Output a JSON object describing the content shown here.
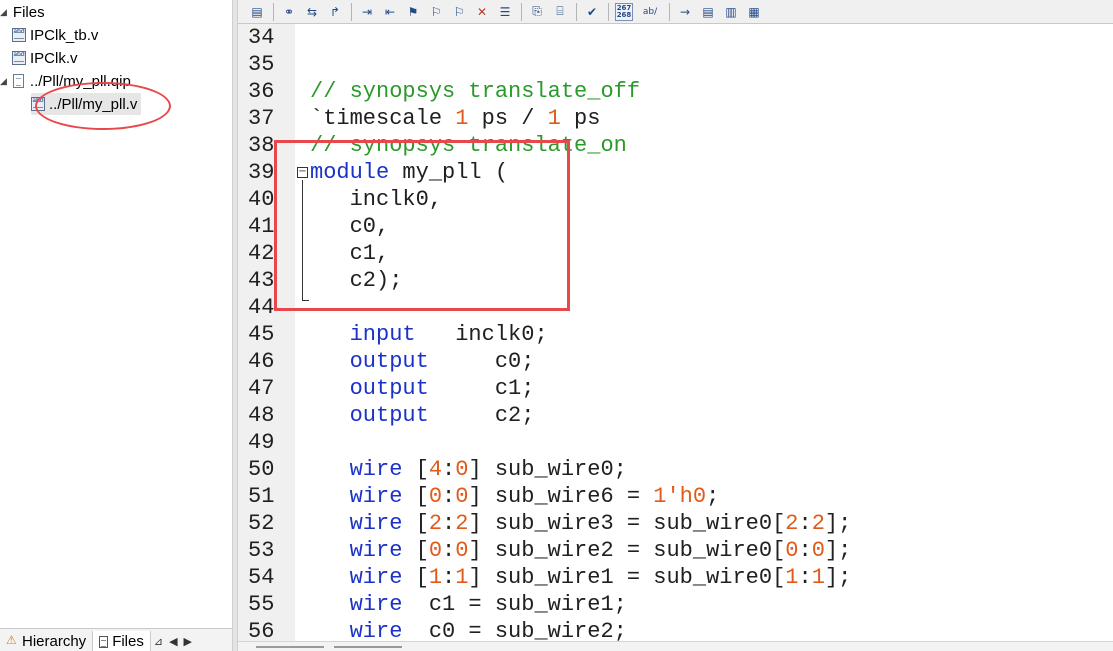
{
  "project_pane": {
    "root_label": "Files",
    "items": [
      {
        "label": "IPClk_tb.v"
      },
      {
        "label": "IPClk.v"
      },
      {
        "label": "../Pll/my_pll.qip"
      },
      {
        "label": "../Pll/my_pll.v"
      }
    ],
    "tabs": [
      {
        "label": "Hierarchy",
        "icon": "warning-hierarchy-icon"
      },
      {
        "label": "Files",
        "icon": "file-icon"
      }
    ]
  },
  "toolbar": {
    "icons": [
      "document-icon",
      "binoculars-icon",
      "replace-icon",
      "goto-icon",
      "indent-icon",
      "unindent-icon",
      "bookmark-icon",
      "bookmark-next-icon",
      "bookmark-prev-icon",
      "bookmark-clear-icon",
      "bookmark-list-icon",
      "paperclip-icon",
      "scroll-icon",
      "check-icon",
      "line-number-icon",
      "ab-icon",
      "arrow-right-icon",
      "text-wrap-icon",
      "text-list-icon",
      "text-block-icon"
    ],
    "line_number_label": "267\n268",
    "ab_label": "ab/"
  },
  "editor": {
    "lines": [
      {
        "n": "34",
        "tokens": []
      },
      {
        "n": "35",
        "tokens": []
      },
      {
        "n": "36",
        "tokens": [
          {
            "t": "// synopsys translate_off",
            "c": "com"
          }
        ]
      },
      {
        "n": "37",
        "tokens": [
          {
            "t": "`timescale ",
            "c": ""
          },
          {
            "t": "1",
            "c": "num"
          },
          {
            "t": " ps / ",
            "c": ""
          },
          {
            "t": "1",
            "c": "num"
          },
          {
            "t": " ps",
            "c": ""
          }
        ]
      },
      {
        "n": "38",
        "tokens": [
          {
            "t": "// synopsys translate_on",
            "c": "com"
          }
        ]
      },
      {
        "n": "39",
        "tokens": [
          {
            "t": "module",
            "c": "kw"
          },
          {
            "t": " my_pll (",
            "c": ""
          }
        ]
      },
      {
        "n": "40",
        "tokens": [
          {
            "t": "   inclk0,",
            "c": ""
          }
        ]
      },
      {
        "n": "41",
        "tokens": [
          {
            "t": "   c0,",
            "c": ""
          }
        ]
      },
      {
        "n": "42",
        "tokens": [
          {
            "t": "   c1,",
            "c": ""
          }
        ]
      },
      {
        "n": "43",
        "tokens": [
          {
            "t": "   c2);",
            "c": ""
          }
        ]
      },
      {
        "n": "44",
        "tokens": []
      },
      {
        "n": "45",
        "tokens": [
          {
            "t": "   ",
            "c": ""
          },
          {
            "t": "input",
            "c": "kw"
          },
          {
            "t": "   inclk0;",
            "c": ""
          }
        ]
      },
      {
        "n": "46",
        "tokens": [
          {
            "t": "   ",
            "c": ""
          },
          {
            "t": "output",
            "c": "kw"
          },
          {
            "t": "     c0;",
            "c": ""
          }
        ]
      },
      {
        "n": "47",
        "tokens": [
          {
            "t": "   ",
            "c": ""
          },
          {
            "t": "output",
            "c": "kw"
          },
          {
            "t": "     c1;",
            "c": ""
          }
        ]
      },
      {
        "n": "48",
        "tokens": [
          {
            "t": "   ",
            "c": ""
          },
          {
            "t": "output",
            "c": "kw"
          },
          {
            "t": "     c2;",
            "c": ""
          }
        ]
      },
      {
        "n": "49",
        "tokens": []
      },
      {
        "n": "50",
        "tokens": [
          {
            "t": "   ",
            "c": ""
          },
          {
            "t": "wire",
            "c": "kw"
          },
          {
            "t": " [",
            "c": ""
          },
          {
            "t": "4",
            "c": "num"
          },
          {
            "t": ":",
            "c": ""
          },
          {
            "t": "0",
            "c": "num"
          },
          {
            "t": "] sub_wire0;",
            "c": ""
          }
        ]
      },
      {
        "n": "51",
        "tokens": [
          {
            "t": "   ",
            "c": ""
          },
          {
            "t": "wire",
            "c": "kw"
          },
          {
            "t": " [",
            "c": ""
          },
          {
            "t": "0",
            "c": "num"
          },
          {
            "t": ":",
            "c": ""
          },
          {
            "t": "0",
            "c": "num"
          },
          {
            "t": "] sub_wire6 = ",
            "c": ""
          },
          {
            "t": "1'h0",
            "c": "num"
          },
          {
            "t": ";",
            "c": ""
          }
        ]
      },
      {
        "n": "52",
        "tokens": [
          {
            "t": "   ",
            "c": ""
          },
          {
            "t": "wire",
            "c": "kw"
          },
          {
            "t": " [",
            "c": ""
          },
          {
            "t": "2",
            "c": "num"
          },
          {
            "t": ":",
            "c": ""
          },
          {
            "t": "2",
            "c": "num"
          },
          {
            "t": "] sub_wire3 = sub_wire0[",
            "c": ""
          },
          {
            "t": "2",
            "c": "num"
          },
          {
            "t": ":",
            "c": ""
          },
          {
            "t": "2",
            "c": "num"
          },
          {
            "t": "];",
            "c": ""
          }
        ]
      },
      {
        "n": "53",
        "tokens": [
          {
            "t": "   ",
            "c": ""
          },
          {
            "t": "wire",
            "c": "kw"
          },
          {
            "t": " [",
            "c": ""
          },
          {
            "t": "0",
            "c": "num"
          },
          {
            "t": ":",
            "c": ""
          },
          {
            "t": "0",
            "c": "num"
          },
          {
            "t": "] sub_wire2 = sub_wire0[",
            "c": ""
          },
          {
            "t": "0",
            "c": "num"
          },
          {
            "t": ":",
            "c": ""
          },
          {
            "t": "0",
            "c": "num"
          },
          {
            "t": "];",
            "c": ""
          }
        ]
      },
      {
        "n": "54",
        "tokens": [
          {
            "t": "   ",
            "c": ""
          },
          {
            "t": "wire",
            "c": "kw"
          },
          {
            "t": " [",
            "c": ""
          },
          {
            "t": "1",
            "c": "num"
          },
          {
            "t": ":",
            "c": ""
          },
          {
            "t": "1",
            "c": "num"
          },
          {
            "t": "] sub_wire1 = sub_wire0[",
            "c": ""
          },
          {
            "t": "1",
            "c": "num"
          },
          {
            "t": ":",
            "c": ""
          },
          {
            "t": "1",
            "c": "num"
          },
          {
            "t": "];",
            "c": ""
          }
        ]
      },
      {
        "n": "55",
        "tokens": [
          {
            "t": "   ",
            "c": ""
          },
          {
            "t": "wire",
            "c": "kw"
          },
          {
            "t": "  c1 = sub_wire1;",
            "c": ""
          }
        ]
      },
      {
        "n": "56",
        "tokens": [
          {
            "t": "   ",
            "c": ""
          },
          {
            "t": "wire",
            "c": "kw"
          },
          {
            "t": "  c0 = sub_wire2;",
            "c": ""
          }
        ]
      }
    ]
  },
  "colors": {
    "comment": "#2a9a2a",
    "keyword": "#1b32c9",
    "number": "#e05a1a",
    "annotation": "#e8474c"
  }
}
